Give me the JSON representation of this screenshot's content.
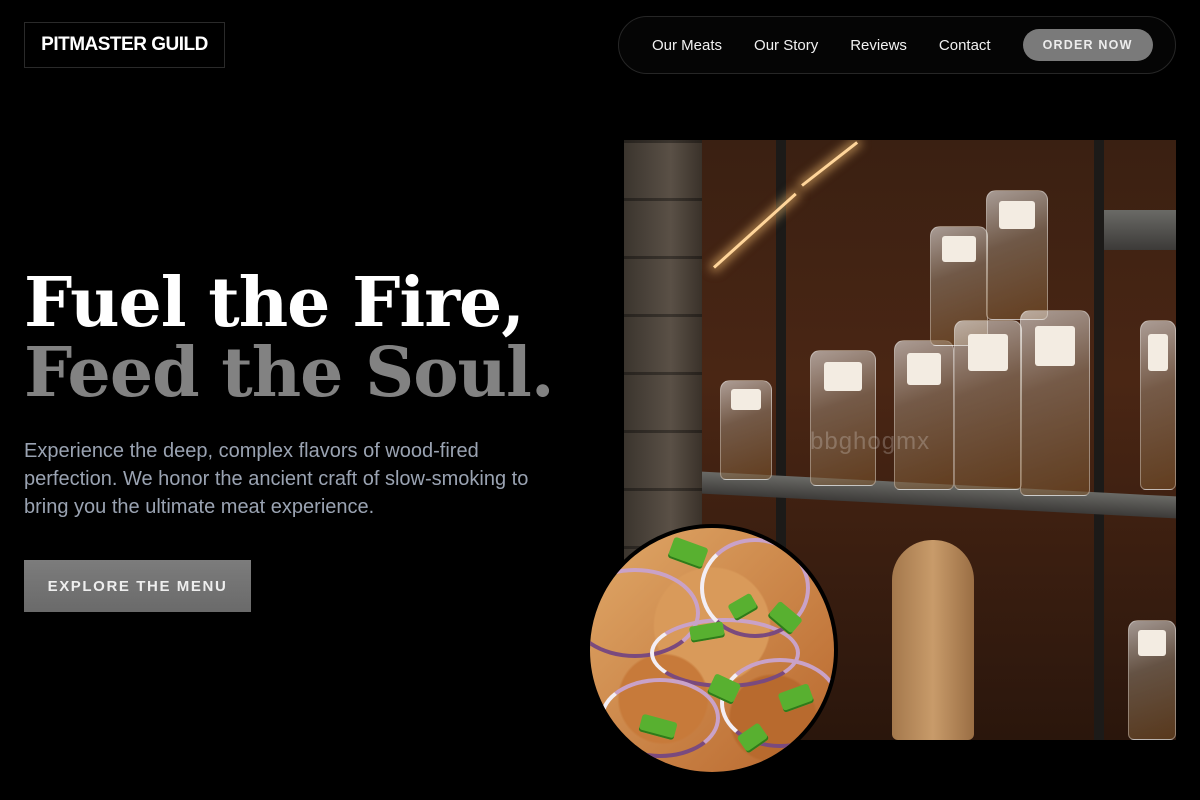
{
  "brand": {
    "name": "PITMASTER GUILD"
  },
  "nav": {
    "links": [
      "Our Meats",
      "Our Story",
      "Reviews",
      "Contact"
    ],
    "cta_label": "ORDER NOW"
  },
  "hero": {
    "headline_line1": "Fuel the Fire,",
    "headline_line2": "Feed the Soul.",
    "subtext": "Experience the deep, complex flavors of wood-fired perfection. We honor the ancient craft of slow-smoking to bring you the ultimate meat experience.",
    "cta_label": "EXPLORE THE MENU"
  },
  "images": {
    "shop_watermark": "bbghogmx"
  },
  "colors": {
    "background": "#000000",
    "headline_primary": "#ffffff",
    "headline_secondary": "#828282",
    "subtext": "#9aa3b2",
    "button_bg": "#767676"
  }
}
